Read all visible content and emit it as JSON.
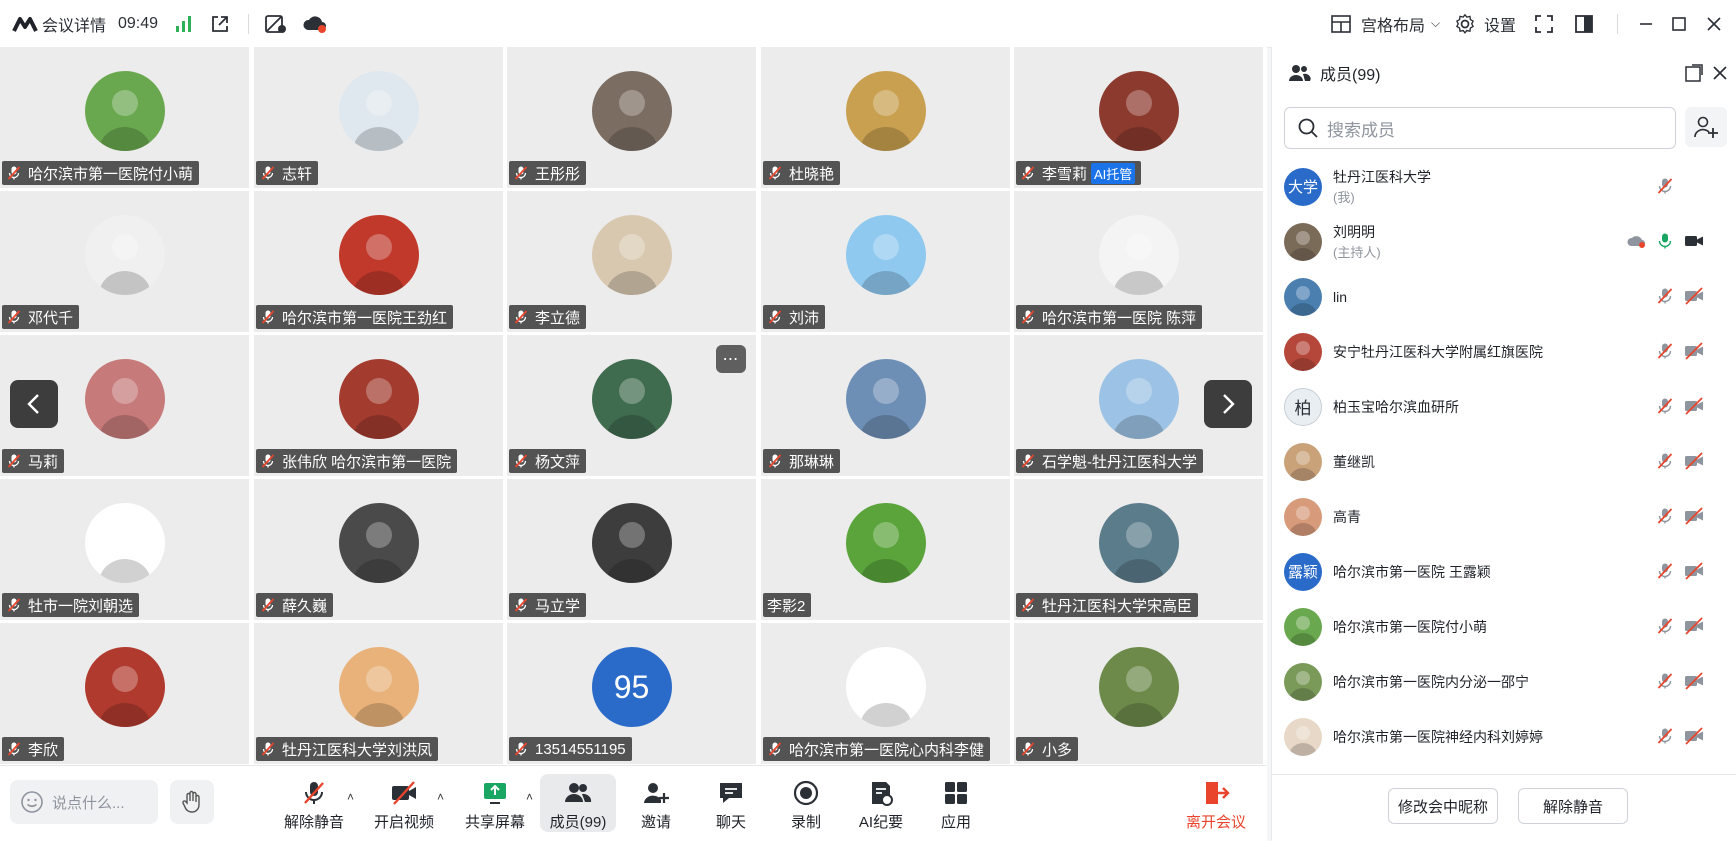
{
  "topbar": {
    "title": "会议详情",
    "time": "09:49",
    "layout_label": "宫格布局",
    "settings_label": "设置"
  },
  "grid": {
    "tiles": [
      {
        "name": "哈尔滨市第一医院付小萌",
        "muted": true,
        "color": "#6aa84f"
      },
      {
        "name": "志轩",
        "muted": true,
        "color": "#dfe8ee"
      },
      {
        "name": "王彤彤",
        "muted": true,
        "color": "#7b6d62"
      },
      {
        "name": "杜晓艳",
        "muted": true,
        "color": "#c8a050"
      },
      {
        "name": "李雪莉",
        "muted": true,
        "badge": "AI托管",
        "color": "#8c3a2e"
      },
      {
        "name": "邓代千",
        "muted": true,
        "color": "#f0f0f0"
      },
      {
        "name": "哈尔滨市第一医院王劲红",
        "muted": true,
        "color": "#c0392b"
      },
      {
        "name": "李立德",
        "muted": true,
        "color": "#d8c8b0"
      },
      {
        "name": "刘沛",
        "muted": true,
        "color": "#8fc9ef"
      },
      {
        "name": "哈尔滨市第一医院 陈萍",
        "muted": true,
        "color": "#f4f4f4"
      },
      {
        "name": "马莉",
        "muted": true,
        "color": "#c77a7a"
      },
      {
        "name": "张伟欣 哈尔滨市第一医院",
        "muted": true,
        "color": "#a33b2f"
      },
      {
        "name": "杨文萍",
        "muted": true,
        "color": "#3f6b4f"
      },
      {
        "name": "那琳琳",
        "muted": true,
        "color": "#6e8fb5"
      },
      {
        "name": "石学魁-牡丹江医科大学",
        "muted": true,
        "color": "#9cc3e5"
      },
      {
        "name": "牡市一院刘朝选",
        "muted": true,
        "color": "#ffffff"
      },
      {
        "name": "薛久巍",
        "muted": true,
        "color": "#4a4a4a"
      },
      {
        "name": "马立学",
        "muted": true,
        "color": "#3d3d3d"
      },
      {
        "name": "李影2",
        "muted": false,
        "color": "#5aa43b"
      },
      {
        "name": "牡丹江医科大学宋高臣",
        "muted": true,
        "color": "#5b7c8a"
      },
      {
        "name": "李欣",
        "muted": true,
        "color": "#b03a2e"
      },
      {
        "name": "牡丹江医科大学刘洪凤",
        "muted": true,
        "color": "#e9b27a"
      },
      {
        "name": "13514551195",
        "muted": true,
        "initials": "95",
        "color": "#2a6bc9"
      },
      {
        "name": "哈尔滨市第一医院心内科李健",
        "muted": true,
        "color": "#ffffff"
      },
      {
        "name": "小多",
        "muted": true,
        "color": "#6d8a4a"
      }
    ]
  },
  "toolbar": {
    "chat_placeholder": "说点什么...",
    "unmute": "解除静音",
    "video": "开启视频",
    "share": "共享屏幕",
    "members": "成员(99)",
    "invite": "邀请",
    "chat": "聊天",
    "record": "录制",
    "ai_notes": "AI纪要",
    "apps": "应用",
    "leave": "离开会议"
  },
  "panel": {
    "title": "成员(99)",
    "search_placeholder": "搜索成员",
    "members": [
      {
        "name": "牡丹江医科大学",
        "sub": "(我)",
        "initials": "大学",
        "color": "#2a6bc9"
      },
      {
        "name": "刘明明",
        "sub": "(主持人)",
        "color": "#7a6a58"
      },
      {
        "name": "lin",
        "sub": "",
        "color": "#4a7fb0"
      },
      {
        "name": "安宁牡丹江医科大学附属红旗医院",
        "sub": "",
        "color": "#b5473a"
      },
      {
        "name": "柏玉宝哈尔滨血研所",
        "sub": "",
        "initials": "柏",
        "color": "#e8eef2"
      },
      {
        "name": "董继凯",
        "sub": "",
        "color": "#c9a27a"
      },
      {
        "name": "高青",
        "sub": "",
        "color": "#d79a7a"
      },
      {
        "name": "哈尔滨市第一医院 王露颖",
        "sub": "",
        "initials": "露颖",
        "color": "#2a6bc9"
      },
      {
        "name": "哈尔滨市第一医院付小萌",
        "sub": "",
        "color": "#6aa84f"
      },
      {
        "name": "哈尔滨市第一医院内分泌一邵宁",
        "sub": "",
        "color": "#7a9a5a"
      },
      {
        "name": "哈尔滨市第一医院神经内科刘婷婷",
        "sub": "",
        "color": "#e8d8c8"
      }
    ],
    "rename_button": "修改会中昵称",
    "unmute_button": "解除静音"
  }
}
